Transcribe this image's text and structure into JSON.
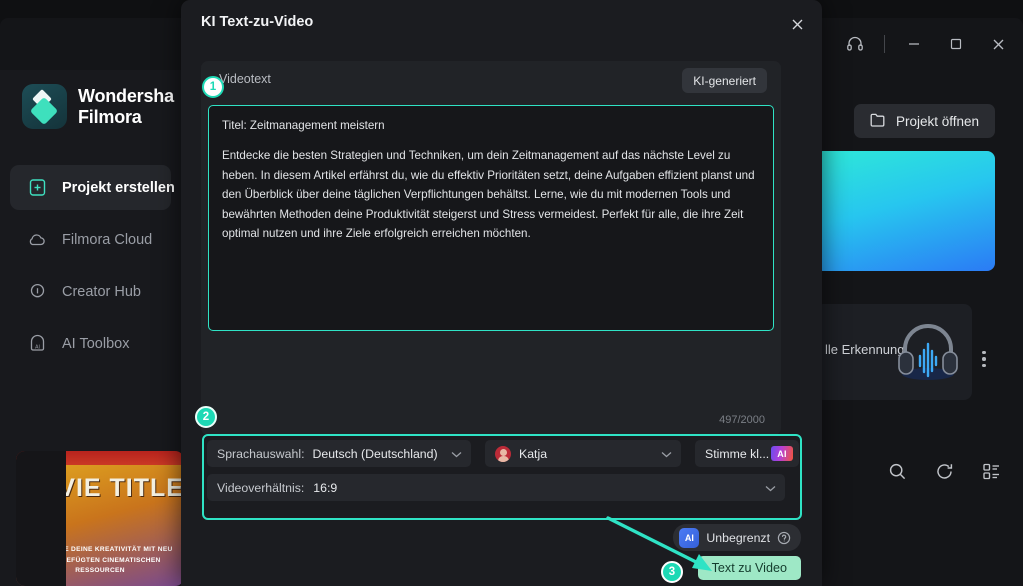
{
  "app": {
    "brand_line1": "Wondersha",
    "brand_line2": "Filmora",
    "logo_icon": "filmora-logo-icon",
    "titlebar": {
      "grid_icon": "grid-list-icon",
      "support_icon": "headset-support-icon",
      "minimize_icon": "minimize-icon",
      "maximize_icon": "maximize-icon",
      "close_icon": "close-icon"
    },
    "sidebar": {
      "items": [
        {
          "label": "Projekt erstellen",
          "icon": "new-project-icon",
          "active": true
        },
        {
          "label": "Filmora Cloud",
          "icon": "cloud-icon",
          "active": false
        },
        {
          "label": "Creator Hub",
          "icon": "lightbulb-icon",
          "active": false
        },
        {
          "label": "AI Toolbox",
          "icon": "ai-toolbox-icon",
          "active": false
        }
      ],
      "promo": {
        "title": "MOVIE TITLE",
        "subtitle": "ENTFESSLE DEINE KREATIVITÄT MIT NEU HINZUGEFÜGTEN CINEMATISCHEN RESSOURCEN"
      }
    },
    "content": {
      "open_project_label": "Projekt öffnen",
      "open_project_icon": "folder-icon",
      "tool_card_label": "lle Erkennung",
      "tool_card_icon": "headphones-icon",
      "kebab_icon": "more-options-icon",
      "bottom_icons": [
        "search-icon",
        "refresh-icon",
        "list-view-icon"
      ]
    },
    "colors": {
      "accent_teal": "#2fe3c5",
      "cta_green": "#9ee8c6",
      "gradient_start": "#2ee8d8",
      "gradient_end": "#2b7bf5"
    }
  },
  "dialog": {
    "title": "KI Text-zu-Video",
    "close_icon": "close-icon",
    "panel": {
      "label": "Videotext",
      "ai_generate_label": "KI-generiert",
      "text_title": "Titel: Zeitmanagement meistern",
      "text_body": "Entdecke die besten Strategien und Techniken, um dein Zeitmanagement auf das nächste Level zu heben. In diesem Artikel erfährst du, wie du effektiv Prioritäten setzt, deine Aufgaben effizient planst und den Überblick über deine täglichen Verpflichtungen behältst. Lerne, wie du mit modernen Tools und bewährten Methoden deine Produktivität steigerst und Stress vermeidest. Perfekt für alle, die ihre Zeit optimal nutzen und ihre Ziele erfolgreich erreichen möchten.",
      "counter": "497/2000"
    },
    "options": {
      "language_label": "Sprachauswahl:",
      "language_value": "Deutsch (Deutschland)",
      "voice_value": "Katja",
      "voice_avatar_icon": "voice-avatar-icon",
      "clone_label": "Stimme kl...",
      "clone_badge": "AI",
      "ratio_label": "Videoverhältnis:",
      "ratio_value": "16:9",
      "chevron_icon": "chevron-down-icon"
    },
    "footer": {
      "unlimited_badge": "AI",
      "unlimited_label": "Unbegrenzt",
      "help_icon": "help-circle-icon",
      "cta_label": "Text zu Video"
    }
  },
  "annotations": {
    "badges": [
      {
        "number": "1"
      },
      {
        "number": "2"
      },
      {
        "number": "3"
      }
    ],
    "arrow_icon": "arrow-pointer-icon"
  }
}
